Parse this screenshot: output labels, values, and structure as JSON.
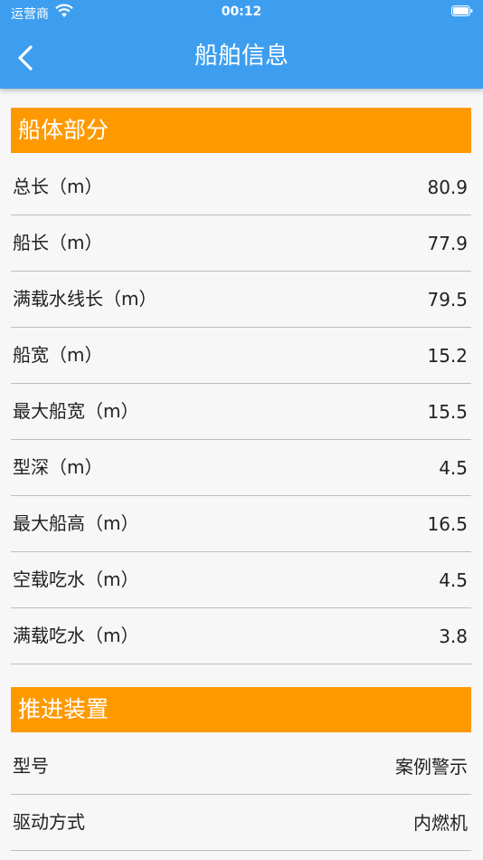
{
  "status_bar": {
    "carrier": "运营商",
    "time": "00:12"
  },
  "nav": {
    "title": "船舶信息"
  },
  "hull": {
    "title": "船体部分",
    "rows": [
      {
        "label": "总长（m）",
        "value": "80.9"
      },
      {
        "label": "船长（m）",
        "value": "77.9"
      },
      {
        "label": "满载水线长（m）",
        "value": "79.5"
      },
      {
        "label": "船宽（m）",
        "value": "15.2"
      },
      {
        "label": "最大船宽（m）",
        "value": "15.5"
      },
      {
        "label": "型深（m）",
        "value": "4.5"
      },
      {
        "label": "最大船高（m）",
        "value": "16.5"
      },
      {
        "label": "空载吃水（m）",
        "value": "4.5"
      },
      {
        "label": "满载吃水（m）",
        "value": "3.8"
      }
    ]
  },
  "propulsion": {
    "title": "推进装置",
    "rows": [
      {
        "label": "型号",
        "value": "案例警示"
      },
      {
        "label": "驱动方式",
        "value": "内燃机"
      }
    ]
  },
  "colors": {
    "header": "#3d9ef0",
    "section": "#ff9900",
    "background": "#f7f7f7"
  }
}
